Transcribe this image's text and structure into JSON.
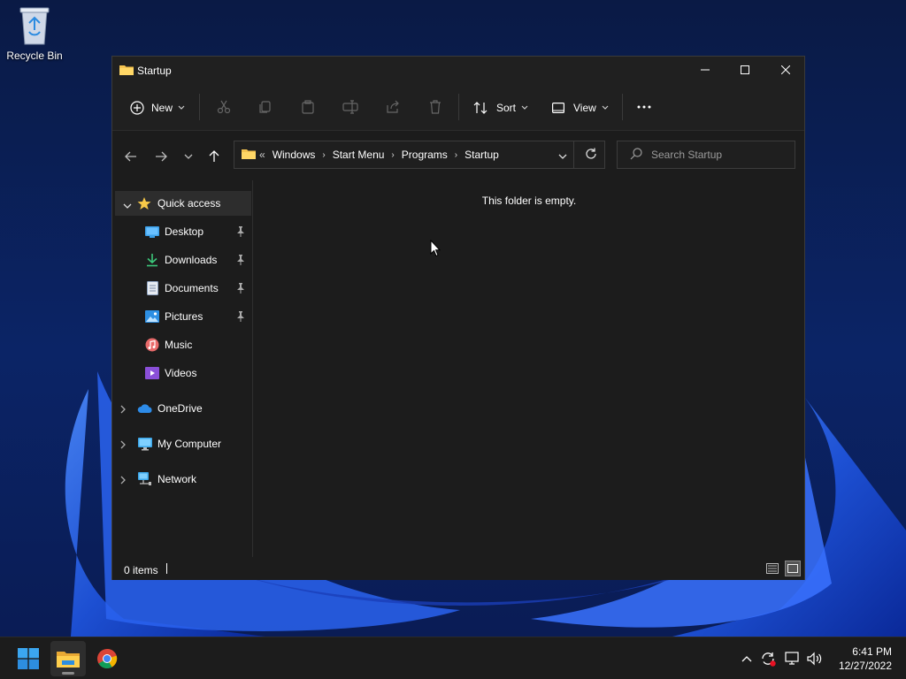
{
  "desktop": {
    "recycle_bin_label": "Recycle Bin"
  },
  "window": {
    "title": "Startup",
    "controls": {
      "minimize": "minimize",
      "maximize": "maximize",
      "close": "close"
    }
  },
  "toolbar": {
    "new_label": "New",
    "sort_label": "Sort",
    "view_label": "View",
    "icons": [
      "cut-icon",
      "copy-icon",
      "paste-icon",
      "rename-icon",
      "share-icon",
      "delete-icon",
      "more-icon"
    ]
  },
  "address": {
    "overflow": "«",
    "crumbs": [
      "Windows",
      "Start Menu",
      "Programs",
      "Startup"
    ]
  },
  "search": {
    "placeholder": "Search Startup"
  },
  "nav": {
    "quick_access": "Quick access",
    "pinned": [
      "Desktop",
      "Downloads",
      "Documents",
      "Pictures"
    ],
    "other": [
      "Music",
      "Videos"
    ],
    "onedrive": "OneDrive",
    "my_computer": "My Computer",
    "network": "Network"
  },
  "content": {
    "empty_message": "This folder is empty."
  },
  "status": {
    "items": "0 items"
  },
  "taskbar": {
    "time": "6:41 PM",
    "date": "12/27/2022",
    "apps": [
      "start-icon",
      "file-explorer-icon",
      "chrome-icon"
    ]
  },
  "colors": {
    "accent": "#0078d4",
    "window_bg": "#1c1c1c",
    "toolbar_bg": "#202020",
    "selection": "#2d2d2d",
    "taskbar_bg": "#1c1c1c"
  }
}
